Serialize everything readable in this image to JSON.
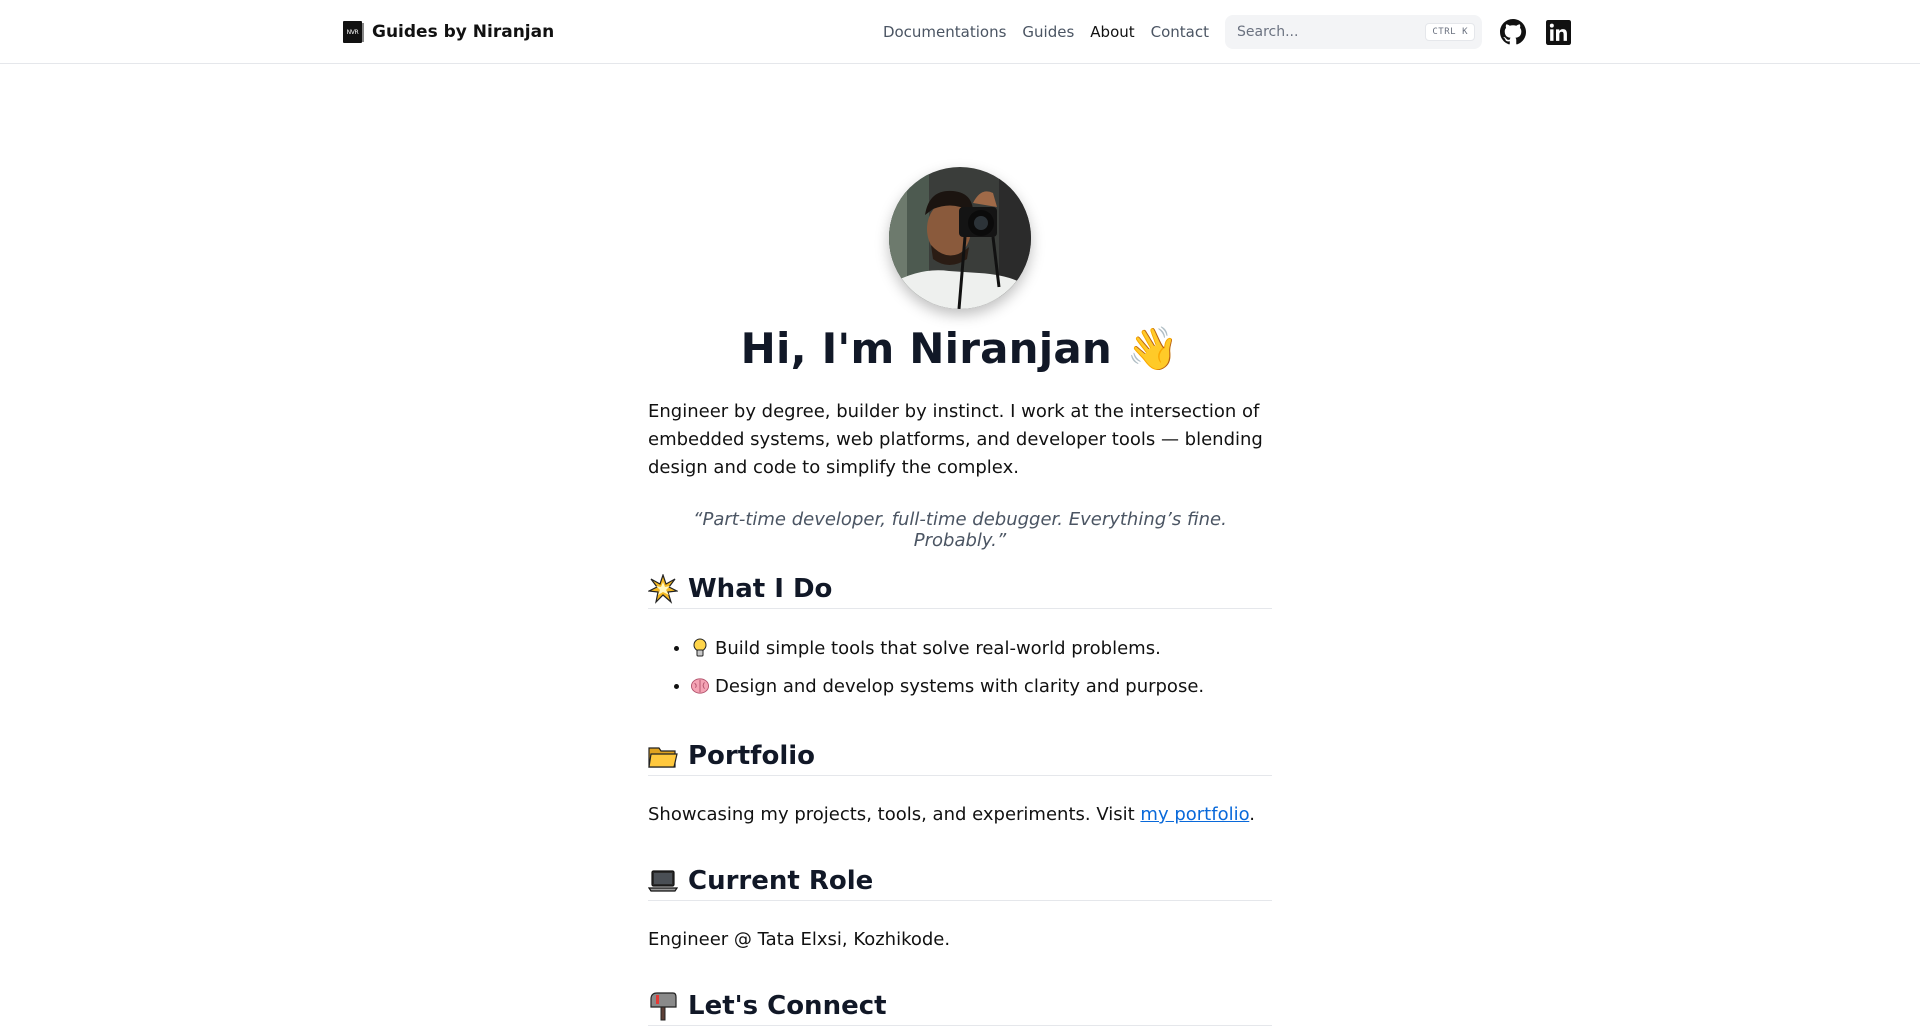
{
  "nav": {
    "brand_logo_text": "NVR",
    "brand_name": "Guides by Niranjan",
    "links": [
      {
        "label": "Documentations"
      },
      {
        "label": "Guides"
      },
      {
        "label": "About"
      },
      {
        "label": "Contact"
      }
    ],
    "active_link": "About",
    "search": {
      "placeholder": "Search...",
      "shortcut_mod": "CTRL",
      "shortcut_key": "K"
    },
    "social": [
      {
        "icon": "github-icon"
      },
      {
        "icon": "linkedin-icon"
      }
    ]
  },
  "hero": {
    "avatar": "profile-photo",
    "title": "Hi, I'm Niranjan 👋",
    "intro": "Engineer by degree, builder by instinct. I work at the intersection of embedded systems, web platforms, and developer tools — blending design and code to simplify the complex.",
    "quote": "“Part-time developer, full-time debugger. Everything’s fine. Probably.”"
  },
  "sections": {
    "what_i_do": {
      "icon": "collision-icon",
      "title": "What I Do",
      "items": [
        {
          "icon": "lightbulb-icon",
          "text": "Build simple tools that solve real-world problems."
        },
        {
          "icon": "brain-icon",
          "text": "Design and develop systems with clarity and purpose."
        }
      ]
    },
    "portfolio": {
      "icon": "folder-icon",
      "title": "Portfolio",
      "text_before": "Showcasing my projects, tools, and experiments. Visit ",
      "link_text": "my portfolio",
      "text_after": "."
    },
    "current_role": {
      "icon": "laptop-icon",
      "title": "Current Role",
      "text": "Engineer @ Tata Elxsi, Kozhikode."
    },
    "connect": {
      "icon": "mailbox-icon",
      "title": "Let's Connect"
    }
  },
  "colors": {
    "link": "#0969da",
    "heading": "#111827",
    "muted": "#4b5563",
    "divider": "#e5e7eb"
  }
}
